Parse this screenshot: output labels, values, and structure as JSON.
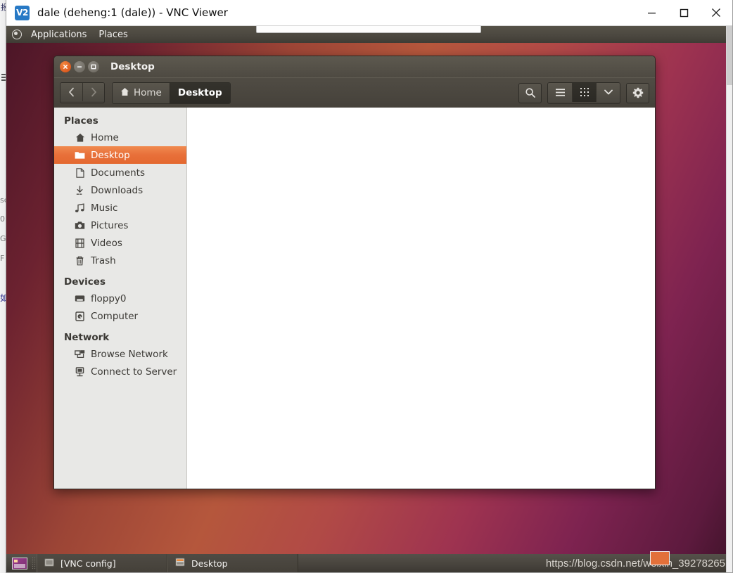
{
  "vnc_window": {
    "logo_text": "V2",
    "title": "dale (deheng:1 (dale)) - VNC Viewer",
    "controls": {
      "minimize": "minimize-icon",
      "maximize": "maximize-icon",
      "close": "close-icon"
    }
  },
  "background_window": {
    "title_fragment": "报",
    "fragments": [
      "sc",
      "0",
      "GV",
      "F",
      "如"
    ]
  },
  "desktop": {
    "top_panel": {
      "logo": "mate-logo-icon",
      "menus": [
        "Applications",
        "Places"
      ]
    },
    "bottom_panel": {
      "show_desktop": "show-desktop-icon",
      "tasks": [
        {
          "label": "[VNC config]",
          "icon": "window-icon"
        },
        {
          "label": "Desktop",
          "icon": "file-manager-icon"
        }
      ],
      "watermark": "https://blog.csdn.net/weixin_39278265"
    }
  },
  "file_manager": {
    "title": "Desktop",
    "window_buttons": {
      "close": "close-icon",
      "minimize": "minimize-icon",
      "maximize": "maximize-icon"
    },
    "nav": {
      "back": "chevron-left-icon",
      "forward": "chevron-right-icon"
    },
    "breadcrumbs": [
      {
        "label": "Home",
        "icon": "home-icon",
        "active": false
      },
      {
        "label": "Desktop",
        "icon": "",
        "active": true
      }
    ],
    "toolbar": {
      "search": "search-icon",
      "list_view": "list-view-icon",
      "grid_view": "grid-view-icon",
      "view_dropdown": "chevron-down-icon",
      "settings": "gear-icon"
    },
    "sidebar": {
      "sections": [
        {
          "heading": "Places",
          "items": [
            {
              "label": "Home",
              "icon": "home-icon",
              "selected": false
            },
            {
              "label": "Desktop",
              "icon": "folder-icon",
              "selected": true
            },
            {
              "label": "Documents",
              "icon": "document-icon",
              "selected": false
            },
            {
              "label": "Downloads",
              "icon": "download-icon",
              "selected": false
            },
            {
              "label": "Music",
              "icon": "music-icon",
              "selected": false
            },
            {
              "label": "Pictures",
              "icon": "camera-icon",
              "selected": false
            },
            {
              "label": "Videos",
              "icon": "film-icon",
              "selected": false
            },
            {
              "label": "Trash",
              "icon": "trash-icon",
              "selected": false
            }
          ]
        },
        {
          "heading": "Devices",
          "items": [
            {
              "label": "floppy0",
              "icon": "floppy-icon",
              "selected": false
            },
            {
              "label": "Computer",
              "icon": "computer-icon",
              "selected": false
            }
          ]
        },
        {
          "heading": "Network",
          "items": [
            {
              "label": "Browse Network",
              "icon": "network-icon",
              "selected": false
            },
            {
              "label": "Connect to Server",
              "icon": "server-icon",
              "selected": false
            }
          ]
        }
      ]
    },
    "files": []
  },
  "colors": {
    "selection_orange": "#e8703a",
    "panel_dark": "#4c4840",
    "vnc_blue": "#2779c5",
    "watermark_box": "#e2703a"
  }
}
